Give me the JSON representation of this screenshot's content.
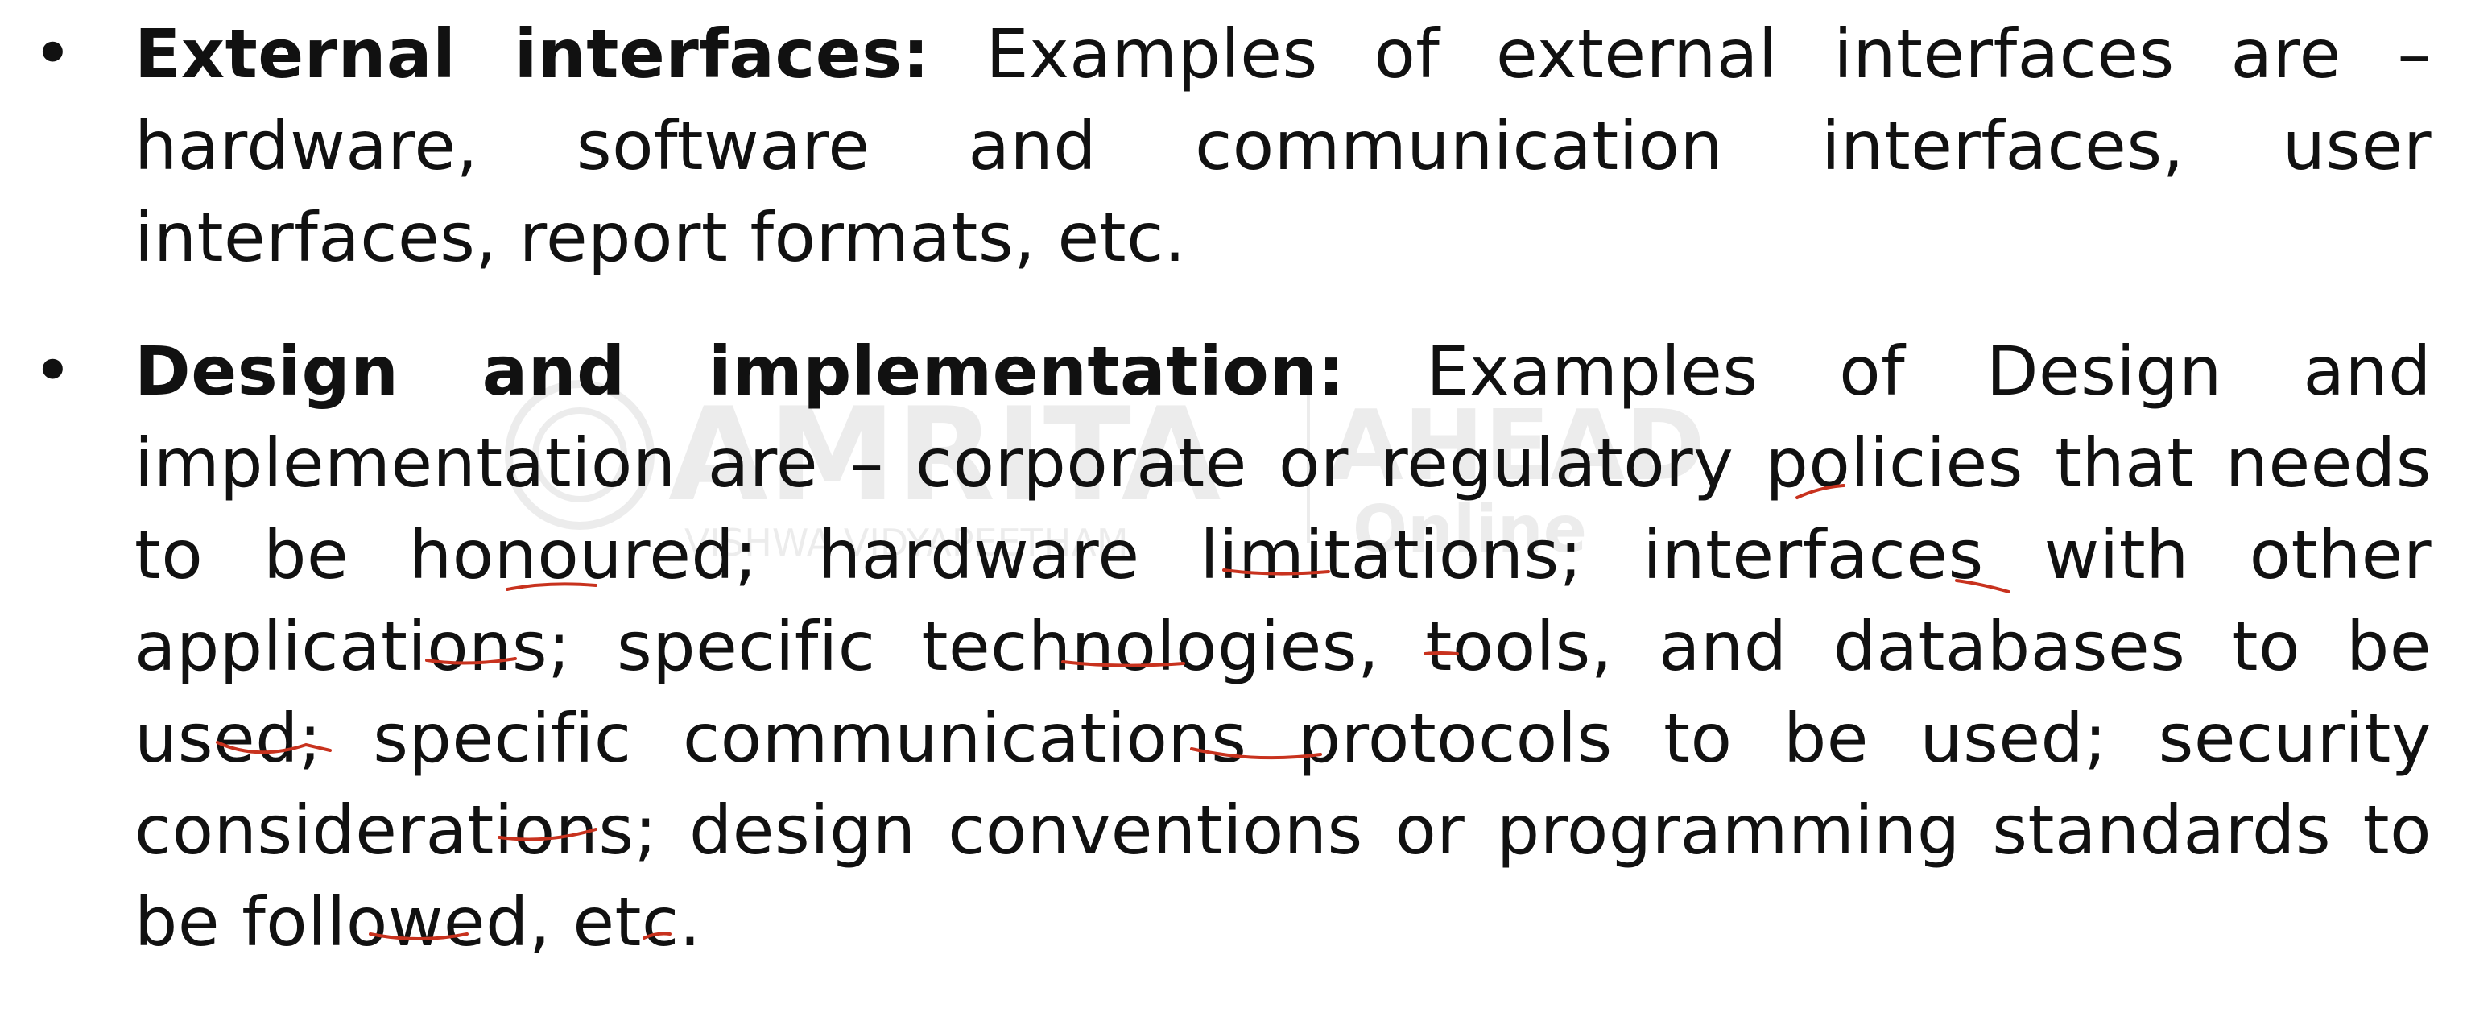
{
  "watermark": {
    "brand": "AMRITA",
    "brand2": "AHEAD",
    "sub": "VISHWA VIDYAPEETHAM",
    "sub2": "Online"
  },
  "bullets": [
    {
      "term": "External interfaces:",
      "text": " Examples of external interfaces are – hardware, software and communication interfaces, user interfaces, report formats, etc."
    },
    {
      "term": "Design and implementation:",
      "text": " Examples of Design and implementation are – corporate or regulatory policies that needs to be honoured; hardware limitations; interfaces with other applications; specific technologies, tools, and databases to be used; specific communications protocols to be used; security considerations; design conventions or programming standards to be followed, etc."
    }
  ],
  "colors": {
    "annotation": "#c8321e",
    "text": "#111111"
  }
}
